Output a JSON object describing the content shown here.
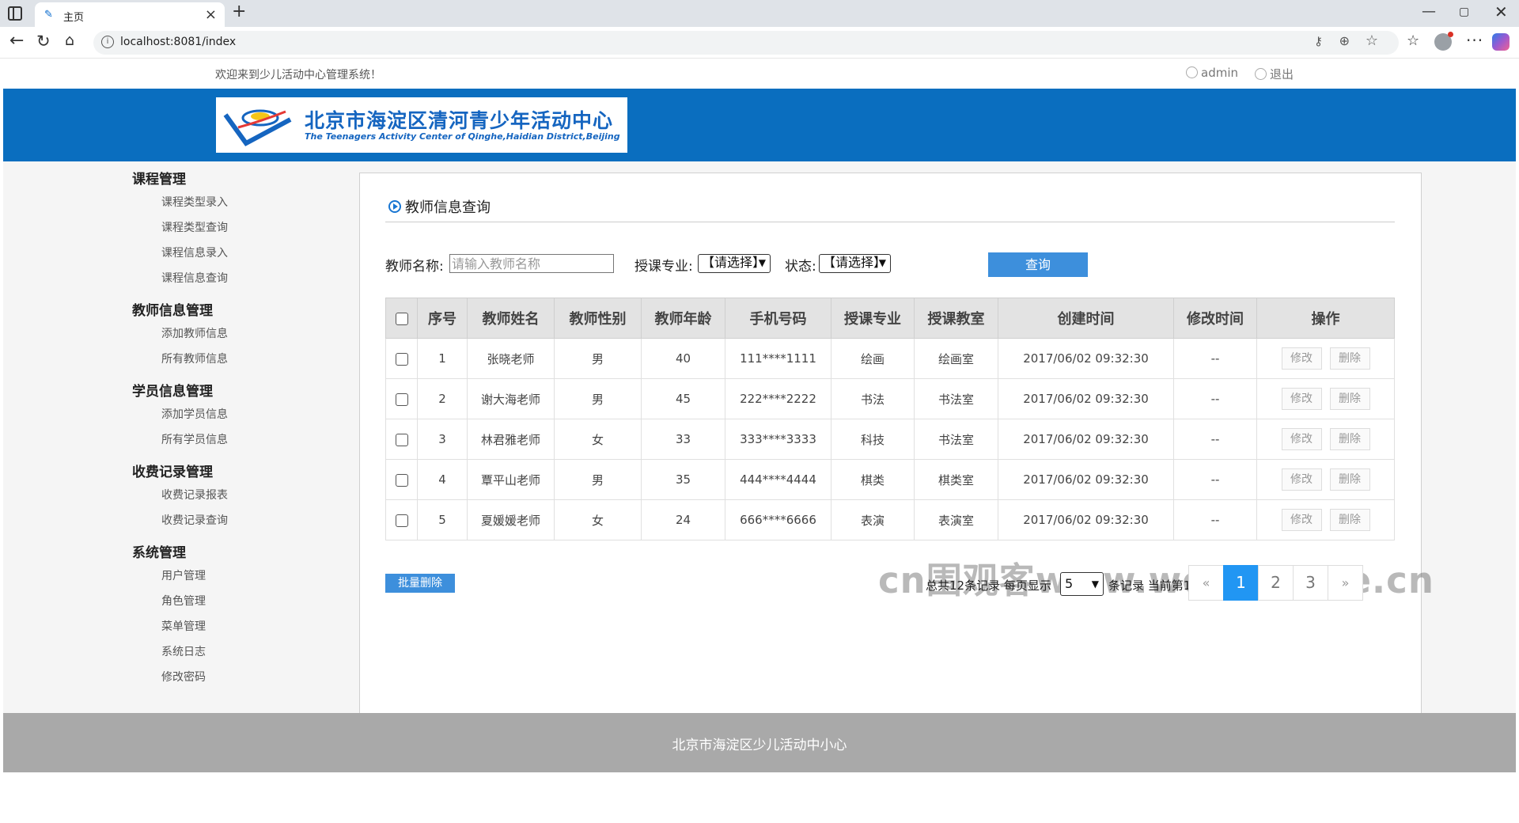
{
  "browser": {
    "tab_title": "主页",
    "tab_close": "×",
    "new_tab": "+",
    "url": "localhost:8081/index",
    "window_controls": {
      "minimize": "—",
      "maximize": "▢",
      "close": "✕"
    },
    "icons": {
      "back": "←",
      "reload": "↻",
      "home": "⌂",
      "info": "i",
      "key": "⚷",
      "zoom": "⊕",
      "star": "☆",
      "favorites": "☆",
      "more": "···"
    }
  },
  "topbar": {
    "welcome": "欢迎来到少儿活动中心管理系统！",
    "user": "admin",
    "logout": "退出"
  },
  "banner": {
    "logo_cn": "北京市海淀区清河青少年活动中心",
    "logo_en": "The Teenagers Activity Center of Qinghe,Haidian District,Beijing"
  },
  "sidebar": {
    "groups": [
      {
        "title": "课程管理",
        "items": [
          "课程类型录入",
          "课程类型查询",
          "课程信息录入",
          "课程信息查询"
        ]
      },
      {
        "title": "教师信息管理",
        "items": [
          "添加教师信息",
          "所有教师信息"
        ]
      },
      {
        "title": "学员信息管理",
        "items": [
          "添加学员信息",
          "所有学员信息"
        ]
      },
      {
        "title": "收费记录管理",
        "items": [
          "收费记录报表",
          "收费记录查询"
        ]
      },
      {
        "title": "系统管理",
        "items": [
          "用户管理",
          "角色管理",
          "菜单管理",
          "系统日志",
          "修改密码"
        ]
      }
    ]
  },
  "main": {
    "title": "教师信息查询",
    "filters": {
      "name_label": "教师名称:",
      "name_placeholder": "请输入教师名称",
      "major_label": "授课专业:",
      "major_value": "【请选择】",
      "status_label": "状态:",
      "status_value": "【请选择】",
      "query_button": "查询"
    },
    "table": {
      "headers": [
        "序号",
        "教师姓名",
        "教师性别",
        "教师年龄",
        "手机号码",
        "授课专业",
        "授课教室",
        "创建时间",
        "修改时间",
        "操作"
      ],
      "edit_label": "修改",
      "delete_label": "删除",
      "rows": [
        [
          "1",
          "张晓老师",
          "男",
          "40",
          "111****1111",
          "绘画",
          "绘画室",
          "2017/06/02 09:32:30",
          "--"
        ],
        [
          "2",
          "谢大海老师",
          "男",
          "45",
          "222****2222",
          "书法",
          "书法室",
          "2017/06/02 09:32:30",
          "--"
        ],
        [
          "3",
          "林君雅老师",
          "女",
          "33",
          "333****3333",
          "科技",
          "书法室",
          "2017/06/02 09:32:30",
          "--"
        ],
        [
          "4",
          "覃平山老师",
          "男",
          "35",
          "444****4444",
          "棋类",
          "棋类室",
          "2017/06/02 09:32:30",
          "--"
        ],
        [
          "5",
          "夏媛媛老师",
          "女",
          "24",
          "666****6666",
          "表演",
          "表演室",
          "2017/06/02 09:32:30",
          "--"
        ]
      ]
    },
    "batch_delete": "批量删除",
    "pager": {
      "total_text": "总共12条记录   每页显示",
      "page_size": "5",
      "records_text": "条记录   当前第1页",
      "prev": "«",
      "pages": [
        "1",
        "2",
        "3"
      ],
      "next": "»"
    },
    "watermark": "cn围观客www.weiguanke.cn"
  },
  "footer": {
    "text": "北京市海淀区少儿活动中小心"
  },
  "colors": {
    "banner_blue": "#0a6ebf",
    "button_blue": "#3d8fdc",
    "active_page": "#2196f3",
    "footer_gray": "#a9a9a9"
  }
}
